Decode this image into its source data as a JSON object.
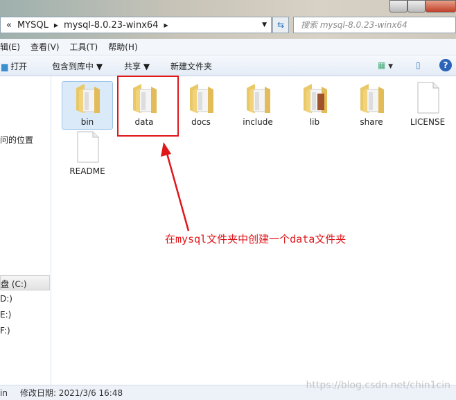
{
  "address": {
    "parts": [
      "«",
      "MYSQL",
      "mysql-8.0.23-winx64"
    ],
    "search_placeholder": "搜索 mysql-8.0.23-winx64"
  },
  "menu": [
    "辑(E)",
    "查看(V)",
    "工具(T)",
    "帮助(H)"
  ],
  "toolbar": {
    "open": "打开",
    "include": "包含到库中 ▼",
    "share": "共享 ▼",
    "new_folder": "新建文件夹"
  },
  "nav": {
    "recent": "问的位置",
    "drives": [
      "盘 (C:)",
      "D:)",
      "E:)",
      "F:)"
    ]
  },
  "items": [
    {
      "name": "bin",
      "type": "folder"
    },
    {
      "name": "data",
      "type": "folder"
    },
    {
      "name": "docs",
      "type": "folder"
    },
    {
      "name": "include",
      "type": "folder"
    },
    {
      "name": "lib",
      "type": "folder"
    },
    {
      "name": "share",
      "type": "folder"
    },
    {
      "name": "LICENSE",
      "type": "file"
    },
    {
      "name": "README",
      "type": "file"
    }
  ],
  "annotation": "在mysql文件夹中创建一个data文件夹",
  "status": {
    "name": "in",
    "modified": "修改日期: 2021/3/6 16:48"
  },
  "watermark": "https://blog.csdn.net/chin1cin",
  "colors": {
    "annotation": "#e0161a",
    "selection": "#dbeaf9"
  }
}
